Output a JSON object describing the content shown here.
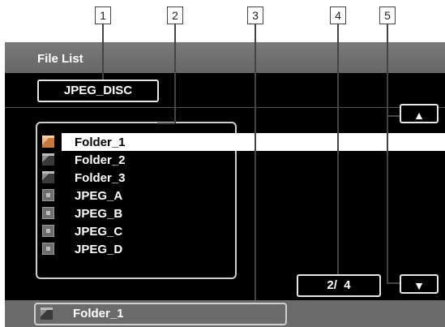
{
  "callouts": [
    "1",
    "2",
    "3",
    "4",
    "5"
  ],
  "title": "File List",
  "disc_label": "JPEG_DISC",
  "items": [
    {
      "label": "Folder_1",
      "type": "folder",
      "selected": true
    },
    {
      "label": "Folder_2",
      "type": "folder",
      "selected": false
    },
    {
      "label": "Folder_3",
      "type": "folder",
      "selected": false
    },
    {
      "label": "JPEG_A",
      "type": "jpeg",
      "selected": false
    },
    {
      "label": "JPEG_B",
      "type": "jpeg",
      "selected": false
    },
    {
      "label": "JPEG_C",
      "type": "jpeg",
      "selected": false
    },
    {
      "label": "JPEG_D",
      "type": "jpeg",
      "selected": false
    }
  ],
  "page_indicator": "2/  4",
  "scroll": {
    "up_icon": "▲",
    "down_icon": "▼"
  },
  "status": {
    "label": "Folder_1",
    "icon": "folder-icon"
  },
  "colors": {
    "selected_folder": "#c77a3f",
    "screen": "#000000",
    "title_bar": "#6b6b6b"
  }
}
